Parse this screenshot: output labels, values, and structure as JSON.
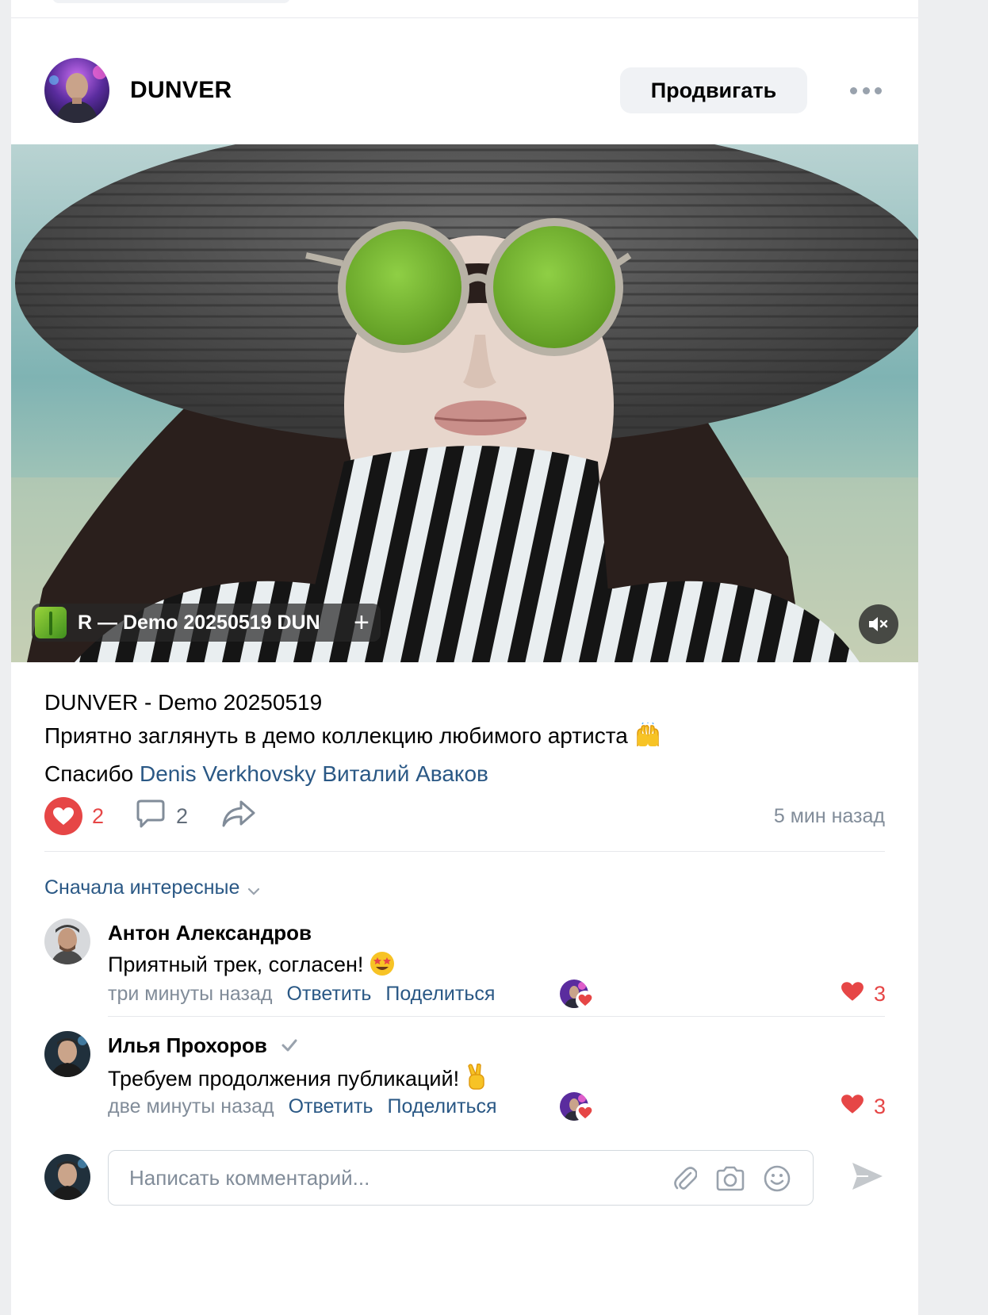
{
  "post": {
    "author": "DUNVER",
    "promote_label": "Продвигать",
    "audio_track": "R — Demo 20250519   DUN",
    "audio_add": "+",
    "title_line": "DUNVER - Demo 20250519",
    "body_line": "Приятно заглянуть в демо коллекцию любимого артиста",
    "thanks_prefix": " Спасибо ",
    "mention_1": "Denis Verkhovsky",
    "mention_2": "Виталий Аваков",
    "likes": "2",
    "comments": "2",
    "time_ago": "5 мин назад"
  },
  "comments_sort": "Сначала интересные",
  "comments": [
    {
      "name": "Антон Александров",
      "text": "Приятный трек, согласен!",
      "time": "три минуты назад",
      "reply_label": "Ответить",
      "share_label": "Поделиться",
      "likes": "3",
      "verified": false
    },
    {
      "name": "Илья Прохоров",
      "text": "Требуем продолжения публикаций!",
      "time": "две минуты назад",
      "reply_label": "Ответить",
      "share_label": "Поделиться",
      "likes": "3",
      "verified": true
    }
  ],
  "composer": {
    "placeholder": "Написать комментарий..."
  },
  "icons": {
    "more": "more-horizontal-icon",
    "mute": "volume-muted-icon",
    "like": "heart-icon",
    "comment": "comment-bubble-icon",
    "share": "share-arrow-icon",
    "attach": "paperclip-icon",
    "camera": "camera-icon",
    "emoji": "smile-icon",
    "send": "send-icon"
  },
  "colors": {
    "accent_link": "#2a5885",
    "like_red": "#e64646",
    "secondary_text": "#818c99",
    "button_bg": "#f0f2f5"
  }
}
